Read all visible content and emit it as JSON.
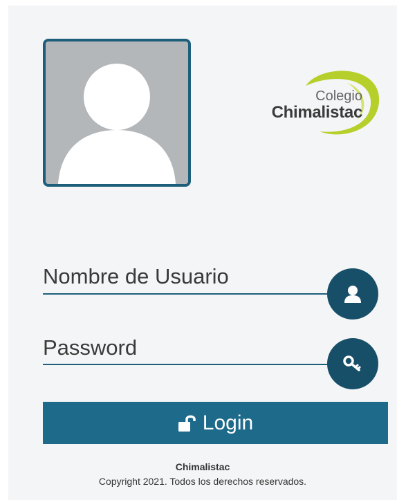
{
  "logo": {
    "line1": "Colegio",
    "line2": "Chimalistac"
  },
  "form": {
    "username_label": "Nombre de Usuario",
    "password_label": "Password",
    "login_label": "Login"
  },
  "icons": {
    "username": "user-icon",
    "password": "key-icon",
    "login": "unlock-icon",
    "avatar": "default-avatar"
  },
  "colors": {
    "accent_dark": "#174f69",
    "accent": "#1d6a8a",
    "logo_green": "#b6cf2b"
  },
  "footer": {
    "title": "Chimalistac",
    "copyright": "Copyright 2021. Todos los derechos reservados."
  }
}
